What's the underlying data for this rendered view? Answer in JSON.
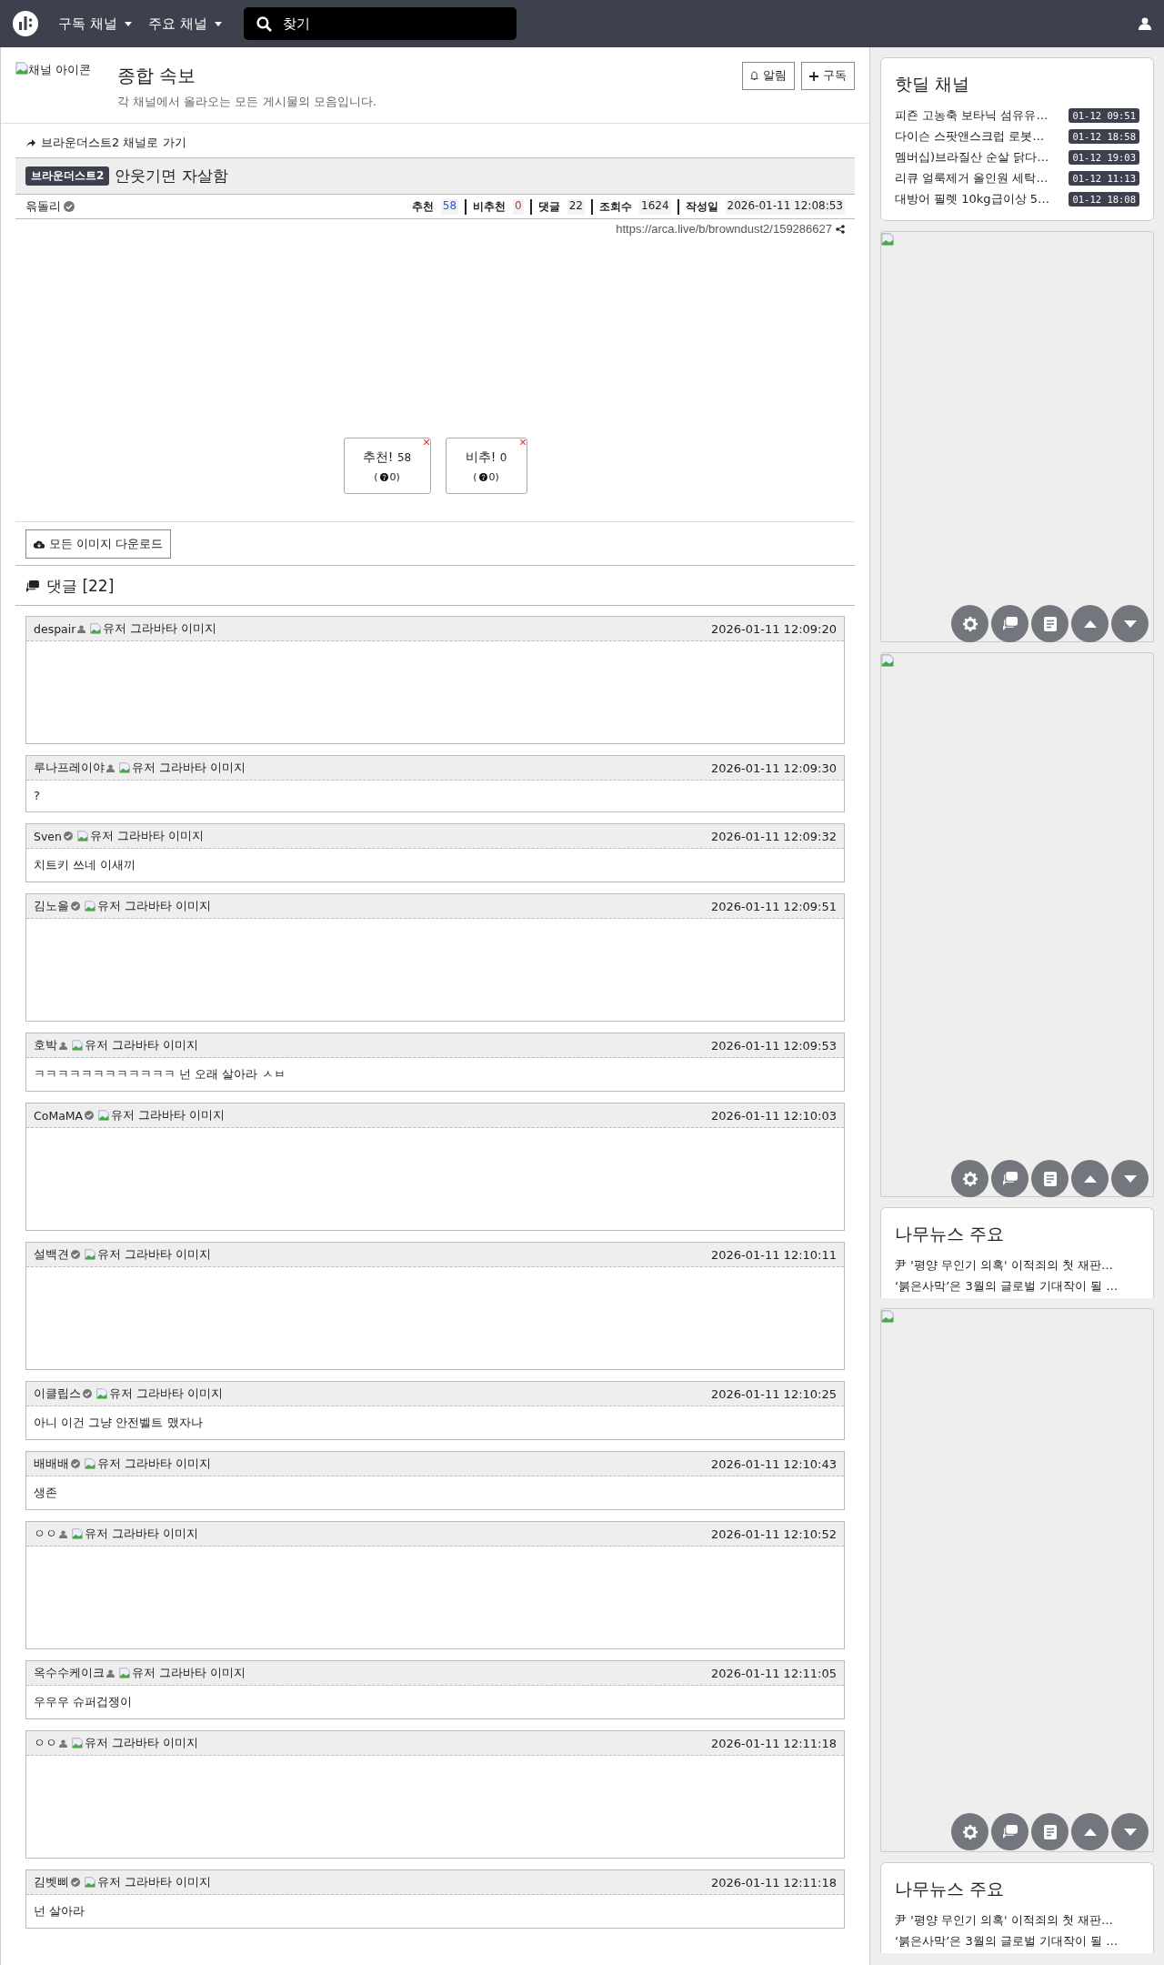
{
  "topbar": {
    "menus": [
      {
        "label": "구독 채널"
      },
      {
        "label": "주요 채널"
      }
    ],
    "search": {
      "placeholder": "찾기"
    }
  },
  "channel": {
    "icon_alt": "채널 아이콘",
    "title": "종합 속보",
    "description": "각 채널에서 올라오는 모든 게시물의 모음입니다.",
    "buttons": [
      {
        "label": "알림",
        "kind": "bell"
      },
      {
        "label": "구독",
        "kind": "plus"
      }
    ]
  },
  "post": {
    "back_link": "브라운더스트2 채널로 가기",
    "category": "브라운더스트2",
    "title": "안웃기면 자살함",
    "author": "윾돌리",
    "verified": true,
    "stats": [
      {
        "label": "추천",
        "value": "58",
        "kind": "up"
      },
      {
        "label": "비추천",
        "value": "0",
        "kind": "down"
      },
      {
        "label": "댓글",
        "value": "22",
        "kind": "plain"
      },
      {
        "label": "조회수",
        "value": "1624",
        "kind": "plain"
      },
      {
        "label": "작성일",
        "value": "2026-01-11 12:08:53",
        "kind": "plain"
      }
    ],
    "url": "https://arca.live/b/browndust2/159286627",
    "votes": [
      {
        "label": "추천!",
        "count": "58",
        "sub_open": "(",
        "sub": "0)"
      },
      {
        "label": "비추!",
        "count": "0",
        "sub_open": "(",
        "sub": "0)"
      }
    ],
    "download_button": "모든 이미지 다운로드"
  },
  "comments": {
    "title": "댓글 [22]",
    "items": [
      {
        "user": "despair",
        "verified": false,
        "avatar_alt": "유저 그라바타 이미지",
        "time": "2026-01-11 12:09:20",
        "kind": "image"
      },
      {
        "user": "루나프레이야",
        "verified": false,
        "avatar_alt": "유저 그라바타 이미지",
        "time": "2026-01-11 12:09:30",
        "kind": "text",
        "text": "?"
      },
      {
        "user": "Sven",
        "verified": true,
        "avatar_alt": "유저 그라바타 이미지",
        "time": "2026-01-11 12:09:32",
        "kind": "text",
        "text": "치트키 쓰네 이새끼"
      },
      {
        "user": "김노을",
        "verified": true,
        "avatar_alt": "유저 그라바타 이미지",
        "time": "2026-01-11 12:09:51",
        "kind": "image"
      },
      {
        "user": "호박",
        "verified": false,
        "avatar_alt": "유저 그라바타 이미지",
        "time": "2026-01-11 12:09:53",
        "kind": "text",
        "text": "ㅋㅋㅋㅋㅋㅋㅋㅋㅋㅋㅋㅋ 넌 오래 살아라 ㅅㅂ"
      },
      {
        "user": "CoMaMA",
        "verified": true,
        "avatar_alt": "유저 그라바타 이미지",
        "time": "2026-01-11 12:10:03",
        "kind": "image"
      },
      {
        "user": "설백견",
        "verified": true,
        "avatar_alt": "유저 그라바타 이미지",
        "time": "2026-01-11 12:10:11",
        "kind": "image"
      },
      {
        "user": "이클립스",
        "verified": true,
        "avatar_alt": "유저 그라바타 이미지",
        "time": "2026-01-11 12:10:25",
        "kind": "text",
        "text": "아니 이건 그냥 안전벨트 맸자나"
      },
      {
        "user": "배배배",
        "verified": true,
        "avatar_alt": "유저 그라바타 이미지",
        "time": "2026-01-11 12:10:43",
        "kind": "text",
        "text": "생존"
      },
      {
        "user": "ㅇㅇ",
        "verified": false,
        "avatar_alt": "유저 그라바타 이미지",
        "time": "2026-01-11 12:10:52",
        "kind": "image"
      },
      {
        "user": "옥수수케이크",
        "verified": false,
        "avatar_alt": "유저 그라바타 이미지",
        "time": "2026-01-11 12:11:05",
        "kind": "text",
        "text": "우우우 슈퍼겁쟁이"
      },
      {
        "user": "ㅇㅇ",
        "verified": false,
        "avatar_alt": "유저 그라바타 이미지",
        "time": "2026-01-11 12:11:18",
        "kind": "image"
      },
      {
        "user": "김벳삐",
        "verified": true,
        "avatar_alt": "유저 그라바타 이미지",
        "time": "2026-01-11 12:11:18",
        "kind": "text",
        "text": "넌 살아라"
      }
    ]
  },
  "sidebar": {
    "hotdeal": {
      "title": "핫딜 채널",
      "items": [
        {
          "title": "피죤 고농축 보타닉 섬유유…",
          "time": "01-12 09:51"
        },
        {
          "title": "다이슨 스팟앤스크럽 로봇…",
          "time": "01-12 18:58"
        },
        {
          "title": "멤버십)브라질산 순살 닭다…",
          "time": "01-12 19:03"
        },
        {
          "title": "리큐 얼룩제거 올인원 세탁…",
          "time": "01-12 11:13"
        },
        {
          "title": "대방어 필렛 10kg급이상 5…",
          "time": "01-12 18:08"
        }
      ]
    },
    "panels": [
      {
        "kind": "ad"
      },
      {
        "kind": "ad"
      },
      {
        "kind": "news",
        "title": "나무뉴스 주요",
        "items": [
          "尹 '평양 무인기 의혹' 이적죄의 첫 재판…",
          "‘붉은사막’은 3월의 글로벌 기대작이 될 …"
        ]
      },
      {
        "kind": "ad"
      },
      {
        "kind": "news",
        "title": "나무뉴스 주요",
        "items": [
          "尹 '평양 무인기 의혹' 이적죄의 첫 재판…",
          "‘붉은사막’은 3월의 글로벌 기대작이 될 …"
        ]
      }
    ]
  }
}
